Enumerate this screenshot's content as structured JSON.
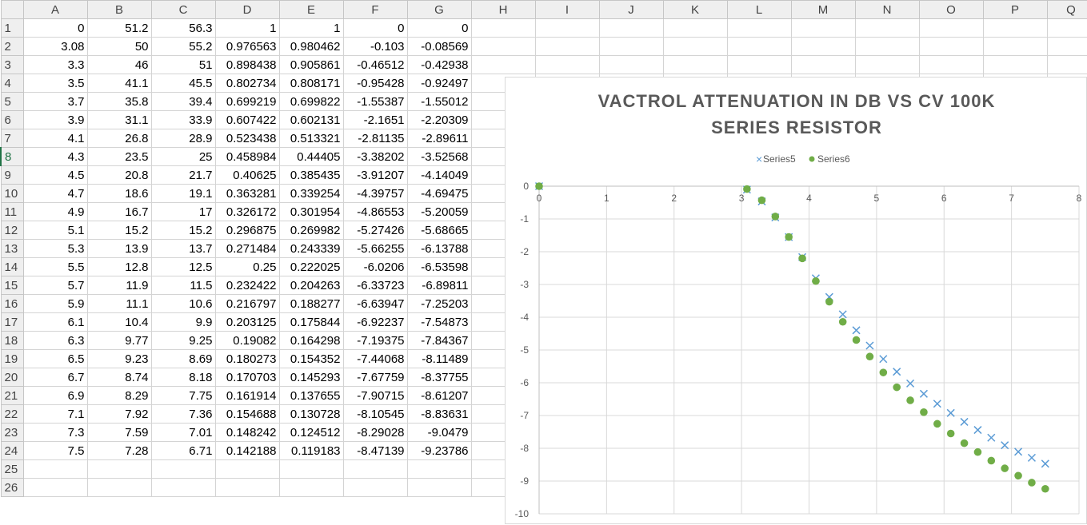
{
  "sheet": {
    "columns": [
      "A",
      "B",
      "C",
      "D",
      "E",
      "F",
      "G",
      "H",
      "I",
      "J",
      "K",
      "L",
      "M",
      "N",
      "O",
      "P",
      "Q"
    ],
    "selected_row": 8,
    "rows": [
      [
        "0",
        "51.2",
        "56.3",
        "1",
        "1",
        "0",
        "0"
      ],
      [
        "3.08",
        "50",
        "55.2",
        "0.976563",
        "0.980462",
        "-0.103",
        "-0.08569"
      ],
      [
        "3.3",
        "46",
        "51",
        "0.898438",
        "0.905861",
        "-0.46512",
        "-0.42938"
      ],
      [
        "3.5",
        "41.1",
        "45.5",
        "0.802734",
        "0.808171",
        "-0.95428",
        "-0.92497"
      ],
      [
        "3.7",
        "35.8",
        "39.4",
        "0.699219",
        "0.699822",
        "-1.55387",
        "-1.55012"
      ],
      [
        "3.9",
        "31.1",
        "33.9",
        "0.607422",
        "0.602131",
        "-2.1651",
        "-2.20309"
      ],
      [
        "4.1",
        "26.8",
        "28.9",
        "0.523438",
        "0.513321",
        "-2.81135",
        "-2.89611"
      ],
      [
        "4.3",
        "23.5",
        "25",
        "0.458984",
        "0.44405",
        "-3.38202",
        "-3.52568"
      ],
      [
        "4.5",
        "20.8",
        "21.7",
        "0.40625",
        "0.385435",
        "-3.91207",
        "-4.14049"
      ],
      [
        "4.7",
        "18.6",
        "19.1",
        "0.363281",
        "0.339254",
        "-4.39757",
        "-4.69475"
      ],
      [
        "4.9",
        "16.7",
        "17",
        "0.326172",
        "0.301954",
        "-4.86553",
        "-5.20059"
      ],
      [
        "5.1",
        "15.2",
        "15.2",
        "0.296875",
        "0.269982",
        "-5.27426",
        "-5.68665"
      ],
      [
        "5.3",
        "13.9",
        "13.7",
        "0.271484",
        "0.243339",
        "-5.66255",
        "-6.13788"
      ],
      [
        "5.5",
        "12.8",
        "12.5",
        "0.25",
        "0.222025",
        "-6.0206",
        "-6.53598"
      ],
      [
        "5.7",
        "11.9",
        "11.5",
        "0.232422",
        "0.204263",
        "-6.33723",
        "-6.89811"
      ],
      [
        "5.9",
        "11.1",
        "10.6",
        "0.216797",
        "0.188277",
        "-6.63947",
        "-7.25203"
      ],
      [
        "6.1",
        "10.4",
        "9.9",
        "0.203125",
        "0.175844",
        "-6.92237",
        "-7.54873"
      ],
      [
        "6.3",
        "9.77",
        "9.25",
        "0.19082",
        "0.164298",
        "-7.19375",
        "-7.84367"
      ],
      [
        "6.5",
        "9.23",
        "8.69",
        "0.180273",
        "0.154352",
        "-7.44068",
        "-8.11489"
      ],
      [
        "6.7",
        "8.74",
        "8.18",
        "0.170703",
        "0.145293",
        "-7.67759",
        "-8.37755"
      ],
      [
        "6.9",
        "8.29",
        "7.75",
        "0.161914",
        "0.137655",
        "-7.90715",
        "-8.61207"
      ],
      [
        "7.1",
        "7.92",
        "7.36",
        "0.154688",
        "0.130728",
        "-8.10545",
        "-8.83631"
      ],
      [
        "7.3",
        "7.59",
        "7.01",
        "0.148242",
        "0.124512",
        "-8.29028",
        "-9.0479"
      ],
      [
        "7.5",
        "7.28",
        "6.71",
        "0.142188",
        "0.119183",
        "-8.47139",
        "-9.23786"
      ],
      [],
      []
    ]
  },
  "chart_data": {
    "type": "scatter",
    "title": "VACTROL ATTENUATION IN DB VS CV 100K SERIES RESISTOR",
    "title_lines": [
      "VACTROL ATTENUATION IN DB VS CV 100K",
      "SERIES RESISTOR"
    ],
    "xlim": [
      0,
      8
    ],
    "ylim": [
      -10,
      0
    ],
    "x_ticks": [
      "0",
      "1",
      "2",
      "3",
      "4",
      "5",
      "6",
      "7",
      "8"
    ],
    "y_ticks": [
      "0",
      "-1",
      "-2",
      "-3",
      "-4",
      "-5",
      "-6",
      "-7",
      "-8",
      "-9",
      "-10"
    ],
    "grid": true,
    "legend_position": "top",
    "series": [
      {
        "name": "Series5",
        "marker": "x",
        "color": "#5b9bd5",
        "x": [
          0,
          3.08,
          3.3,
          3.5,
          3.7,
          3.9,
          4.1,
          4.3,
          4.5,
          4.7,
          4.9,
          5.1,
          5.3,
          5.5,
          5.7,
          5.9,
          6.1,
          6.3,
          6.5,
          6.7,
          6.9,
          7.1,
          7.3,
          7.5
        ],
        "y": [
          0,
          -0.103,
          -0.46512,
          -0.95428,
          -1.55387,
          -2.1651,
          -2.81135,
          -3.38202,
          -3.91207,
          -4.39757,
          -4.86553,
          -5.27426,
          -5.66255,
          -6.0206,
          -6.33723,
          -6.63947,
          -6.92237,
          -7.19375,
          -7.44068,
          -7.67759,
          -7.90715,
          -8.10545,
          -8.29028,
          -8.47139
        ]
      },
      {
        "name": "Series6",
        "marker": "circle",
        "color": "#70ad47",
        "x": [
          0,
          3.08,
          3.3,
          3.5,
          3.7,
          3.9,
          4.1,
          4.3,
          4.5,
          4.7,
          4.9,
          5.1,
          5.3,
          5.5,
          5.7,
          5.9,
          6.1,
          6.3,
          6.5,
          6.7,
          6.9,
          7.1,
          7.3,
          7.5
        ],
        "y": [
          0,
          -0.08569,
          -0.42938,
          -0.92497,
          -1.55012,
          -2.20309,
          -2.89611,
          -3.52568,
          -4.14049,
          -4.69475,
          -5.20059,
          -5.68665,
          -6.13788,
          -6.53598,
          -6.89811,
          -7.25203,
          -7.54873,
          -7.84367,
          -8.11489,
          -8.37755,
          -8.61207,
          -8.83631,
          -9.0479,
          -9.23786
        ]
      }
    ]
  }
}
